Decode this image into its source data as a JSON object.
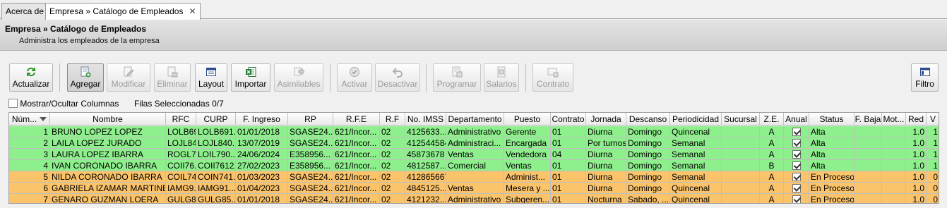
{
  "tabs": [
    {
      "label": "Acerca de",
      "closable": false,
      "active": false
    },
    {
      "label": "Empresa » Catálogo de Empleados",
      "closable": true,
      "active": true
    }
  ],
  "header": {
    "title": "Empresa » Catálogo de Empleados",
    "subtitle": "Administra los empleados de la empresa"
  },
  "toolbar": {
    "actualizar": "Actualizar",
    "agregar": "Agregar",
    "modificar": "Modificar",
    "eliminar": "Eliminar",
    "layout": "Layout",
    "importar": "Importar",
    "asimilables": "Asimilables",
    "activar": "Activar",
    "desactivar": "Desactivar",
    "programar": "Programar",
    "salarios": "Salarios",
    "contrato": "Contrato",
    "filtro": "Filtro"
  },
  "status": {
    "show_columns": "Mostrar/Ocultar Columnas",
    "selected_label": "Filas Seleccionadas",
    "selected_count": "0/7"
  },
  "colors": {
    "active_row": "#8ef08c",
    "process_row": "#fbc36a"
  },
  "grid": {
    "columns": [
      "Núm...",
      "Nombre",
      "RFC",
      "CURP",
      "F. Ingreso",
      "RP",
      "R.F.E",
      "R.F",
      "No. IMSS",
      "Departamento",
      "Puesto",
      "Contrato",
      "Jornada",
      "Descanso",
      "Periodicidad",
      "Sucursal",
      "Z.E.",
      "Anual",
      "Status",
      "F. Baja",
      "Mot...",
      "Red",
      "V"
    ],
    "rows": [
      {
        "num": "1",
        "nombre": "BRUNO LOPEZ LOPEZ",
        "rfc": "LOLB69...",
        "curp": "LOLB691...",
        "ingreso": "01/01/2018",
        "rp": "SGASE24...",
        "rfe": "621/Incor...",
        "rf": "02",
        "imss": "4125633...",
        "depto": "Administrativo",
        "puesto": "Gerente",
        "contrato": "01",
        "jornada": "Diurna",
        "descanso": "Domingo",
        "periodicidad": "Quincenal",
        "sucursal": "",
        "ze": "A",
        "status": "Alta",
        "baja": "",
        "mot": "",
        "red": "1.0",
        "v": "1",
        "state": "active"
      },
      {
        "num": "2",
        "nombre": "LAILA LOPEZ JURADO",
        "rfc": "LOJL84...",
        "curp": "LOJL840...",
        "ingreso": "13/07/2019",
        "rp": "SGASE24...",
        "rfe": "621/Incor...",
        "rf": "02",
        "imss": "412544584",
        "depto": "Administraci...",
        "puesto": "Encargada",
        "contrato": "01",
        "jornada": "Por turnos",
        "descanso": "Domingo",
        "periodicidad": "Semanal",
        "sucursal": "",
        "ze": "A",
        "status": "Alta",
        "baja": "",
        "mot": "",
        "red": "1.0",
        "v": "1",
        "state": "active"
      },
      {
        "num": "3",
        "nombre": "LAURA LOPEZ IBARRA",
        "rfc": "ROGL7...",
        "curp": "LOIL790...",
        "ingreso": "24/06/2024",
        "rp": "E358956...",
        "rfe": "621/Incor...",
        "rf": "02",
        "imss": "45873678",
        "depto": "Ventas",
        "puesto": "Vendedora",
        "contrato": "04",
        "jornada": "Diurna",
        "descanso": "Domingo",
        "periodicidad": "Semanal",
        "sucursal": "",
        "ze": "A",
        "status": "Alta",
        "baja": "",
        "mot": "",
        "red": "1.0",
        "v": "1",
        "state": "active"
      },
      {
        "num": "4",
        "nombre": "IVAN CORONADO IBARRA",
        "rfc": "COII76...",
        "curp": "COII7612...",
        "ingreso": "27/02/2023",
        "rp": "E358956...",
        "rfe": "621/Incor...",
        "rf": "02",
        "imss": "4812587...",
        "depto": "Comercial",
        "puesto": "Ventas",
        "contrato": "01",
        "jornada": "Diurna",
        "descanso": "Domingo",
        "periodicidad": "Semanal",
        "sucursal": "",
        "ze": "B",
        "status": "Alta",
        "baja": "",
        "mot": "",
        "red": "1.0",
        "v": "1",
        "state": "active"
      },
      {
        "num": "5",
        "nombre": "NILDA CORONADO IBARRA",
        "rfc": "COIL74...",
        "curp": "COIN741...",
        "ingreso": "01/03/2023",
        "rp": "SGASE24...",
        "rfe": "621/Incor...",
        "rf": "02",
        "imss": "412865667",
        "depto": "",
        "puesto": "Administ...",
        "contrato": "01",
        "jornada": "Diurna",
        "descanso": "Domingo",
        "periodicidad": "Semanal",
        "sucursal": "",
        "ze": "A",
        "status": "En Proceso",
        "baja": "",
        "mot": "",
        "red": "1.0",
        "v": "0",
        "state": "process"
      },
      {
        "num": "6",
        "nombre": "GABRIELA IZAMAR MARTINEZ",
        "rfc": "IAMG9...",
        "curp": "IAMG91...",
        "ingreso": "01/04/2023",
        "rp": "SGASE24...",
        "rfe": "621/Incor...",
        "rf": "02",
        "imss": "4845125...",
        "depto": "Ventas",
        "puesto": "Mesera y ...",
        "contrato": "01",
        "jornada": "Diurna",
        "descanso": "Domingo",
        "periodicidad": "Quincenal",
        "sucursal": "",
        "ze": "A",
        "status": "En Proceso",
        "baja": "",
        "mot": "",
        "red": "1.0",
        "v": "0",
        "state": "process"
      },
      {
        "num": "7",
        "nombre": "GENARO GUZMAN LOERA",
        "rfc": "GULG8...",
        "curp": "GULG85...",
        "ingreso": "01/01/2018",
        "rp": "SGASE24...",
        "rfe": "621/Incor...",
        "rf": "02",
        "imss": "4121232...",
        "depto": "Administrativo",
        "puesto": "Subgeren...",
        "contrato": "01",
        "jornada": "Nocturna",
        "descanso": "Sabado, ...",
        "periodicidad": "Quincenal",
        "sucursal": "",
        "ze": "A",
        "status": "En Proceso",
        "baja": "",
        "mot": "",
        "red": "1.0",
        "v": "0",
        "state": "process"
      }
    ]
  }
}
